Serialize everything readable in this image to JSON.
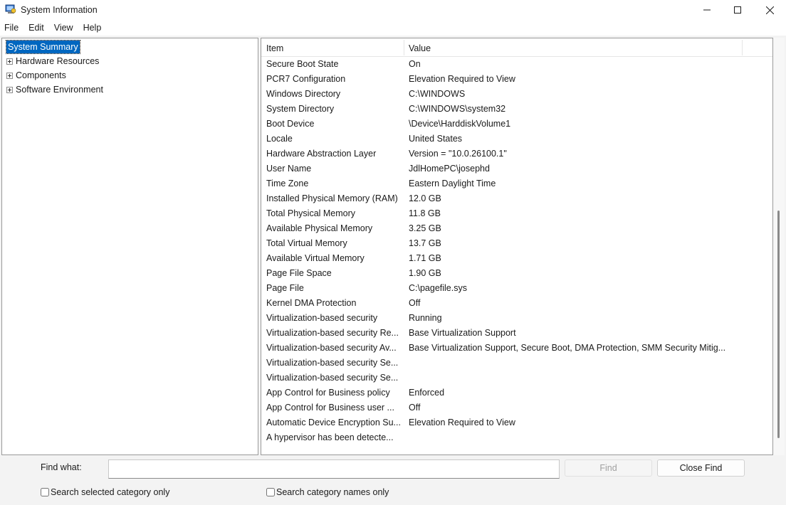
{
  "window": {
    "title": "System Information"
  },
  "menu": {
    "file": "File",
    "edit": "Edit",
    "view": "View",
    "help": "Help"
  },
  "tree": {
    "selected": "System Summary",
    "nodes": [
      "Hardware Resources",
      "Components",
      "Software Environment"
    ]
  },
  "list": {
    "headers": {
      "item": "Item",
      "value": "Value"
    },
    "rows": [
      {
        "item": "Secure Boot State",
        "value": "On"
      },
      {
        "item": "PCR7 Configuration",
        "value": "Elevation Required to View"
      },
      {
        "item": "Windows Directory",
        "value": "C:\\WINDOWS"
      },
      {
        "item": "System Directory",
        "value": "C:\\WINDOWS\\system32"
      },
      {
        "item": "Boot Device",
        "value": "\\Device\\HarddiskVolume1"
      },
      {
        "item": "Locale",
        "value": "United States"
      },
      {
        "item": "Hardware Abstraction Layer",
        "value": "Version = \"10.0.26100.1\""
      },
      {
        "item": "User Name",
        "value": "JdlHomePC\\josephd"
      },
      {
        "item": "Time Zone",
        "value": "Eastern Daylight Time"
      },
      {
        "item": "Installed Physical Memory (RAM)",
        "value": "12.0 GB"
      },
      {
        "item": "Total Physical Memory",
        "value": "11.8 GB"
      },
      {
        "item": "Available Physical Memory",
        "value": "3.25 GB"
      },
      {
        "item": "Total Virtual Memory",
        "value": "13.7 GB"
      },
      {
        "item": "Available Virtual Memory",
        "value": "1.71 GB"
      },
      {
        "item": "Page File Space",
        "value": "1.90 GB"
      },
      {
        "item": "Page File",
        "value": "C:\\pagefile.sys"
      },
      {
        "item": "Kernel DMA Protection",
        "value": "Off"
      },
      {
        "item": "Virtualization-based security",
        "value": "Running"
      },
      {
        "item": "Virtualization-based security Re...",
        "value": "Base Virtualization Support"
      },
      {
        "item": "Virtualization-based security Av...",
        "value": "Base Virtualization Support, Secure Boot, DMA Protection, SMM Security Mitig..."
      },
      {
        "item": "Virtualization-based security Se...",
        "value": ""
      },
      {
        "item": "Virtualization-based security Se...",
        "value": ""
      },
      {
        "item": "App Control for Business policy",
        "value": "Enforced"
      },
      {
        "item": "App Control for Business user ...",
        "value": "Off"
      },
      {
        "item": "Automatic Device Encryption Su...",
        "value": "Elevation Required to View"
      },
      {
        "item": "A hypervisor has been detecte...",
        "value": ""
      }
    ]
  },
  "find": {
    "label": "Find what:",
    "value": "",
    "find_button": "Find",
    "close_button": "Close Find",
    "search_selected": "Search selected category only",
    "search_names": "Search category names only"
  },
  "icons": {
    "app": "system-information-icon",
    "minimize": "minimize-icon",
    "maximize": "maximize-icon",
    "close": "close-icon",
    "expand": "expand-plus-icon"
  }
}
